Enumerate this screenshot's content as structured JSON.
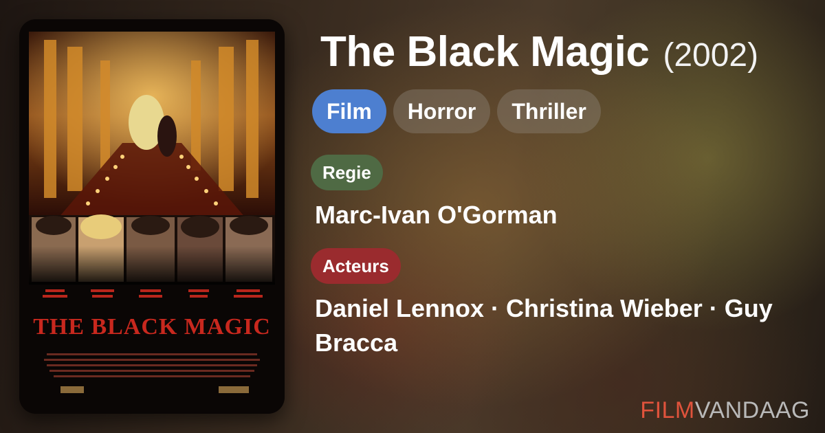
{
  "movie": {
    "title": "The Black Magic",
    "year": "(2002)"
  },
  "genres": [
    "Film",
    "Horror",
    "Thriller"
  ],
  "director": {
    "label": "Regie",
    "name": "Marc-Ivan O'Gorman"
  },
  "cast": {
    "label": "Acteurs",
    "names": "Daniel Lennox · Christina Wieber · Guy Bracca"
  },
  "poster": {
    "title_text": "THE BLACK MAGIC",
    "title_color": "#c8281e"
  },
  "brand": {
    "part1": "FILM",
    "part2": "VANDAAG",
    "part1_color": "#e0533c"
  },
  "colors": {
    "chip_primary": "#4d7fd0",
    "regie_label": "#4f6a44",
    "acteurs_label": "#9a2b2e"
  }
}
